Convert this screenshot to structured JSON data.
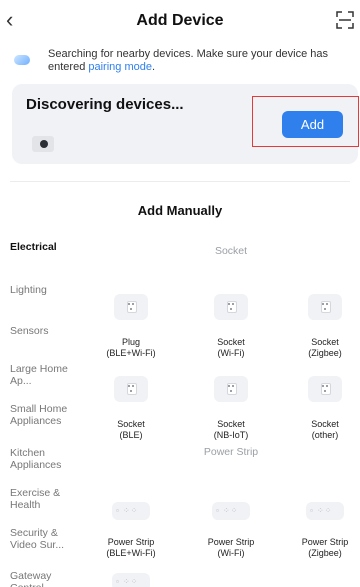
{
  "header": {
    "title": "Add Device",
    "back_icon": "chevron-left-icon",
    "scan_icon": "scan-icon"
  },
  "notice": {
    "text": "Searching for nearby devices. Make sure your device has entered ",
    "link": "pairing mode",
    "suffix": "."
  },
  "discover": {
    "title": "Discovering devices...",
    "add_label": "Add",
    "highlight_color": "#e23b3b",
    "accent": "#2f80ed"
  },
  "manual": {
    "title": "Add Manually"
  },
  "categories": [
    "Electrical",
    "Lighting",
    "Sensors",
    "Large Home Ap...",
    "Small Home Appliances",
    "Kitchen Appliances",
    "Exercise & Health",
    "Security & Video Sur...",
    "Gateway Control"
  ],
  "sections": {
    "socket": "Socket",
    "power_strip": "Power Strip"
  },
  "devices": {
    "plug_ble_wifi": "Plug\n(BLE+Wi-Fi)",
    "socket_wifi": "Socket\n(Wi-Fi)",
    "socket_zigbee": "Socket\n(Zigbee)",
    "socket_ble": "Socket\n(BLE)",
    "socket_nbiot": "Socket\n(NB-IoT)",
    "socket_other": "Socket\n(other)",
    "strip_ble_wifi": "Power Strip\n(BLE+Wi-Fi)",
    "strip_wifi": "Power Strip\n(Wi-Fi)",
    "strip_zigbee": "Power Strip\n(Zigbee)"
  }
}
